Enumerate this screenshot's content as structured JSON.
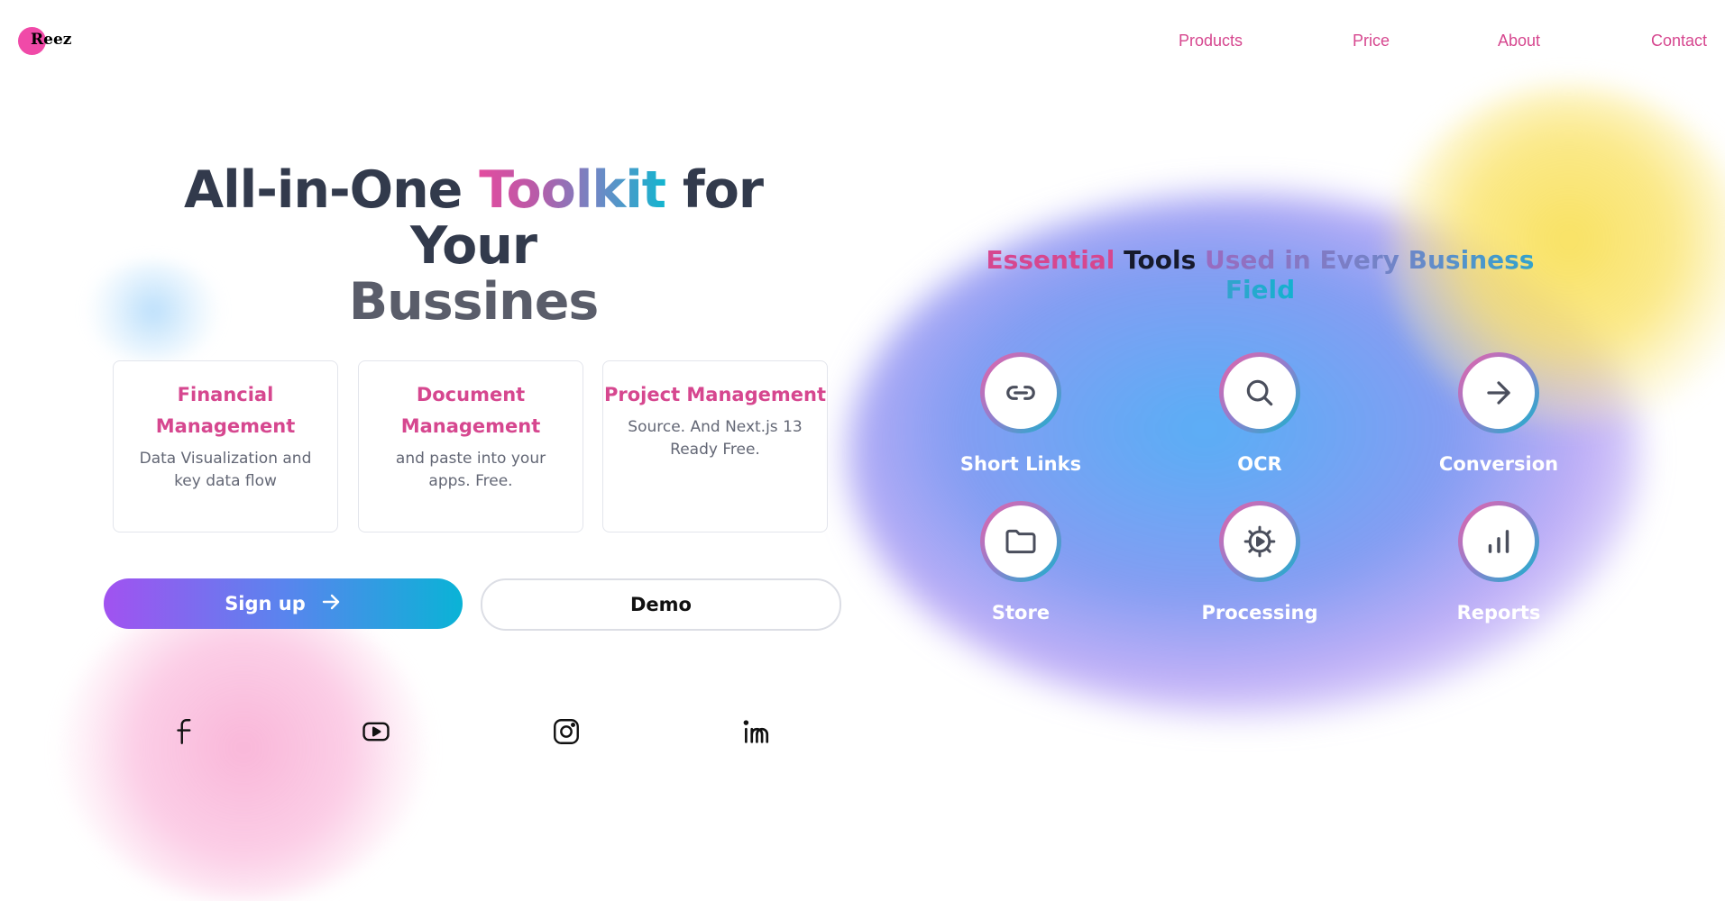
{
  "brand": {
    "name": "Reez",
    "color": "#f04aa8"
  },
  "nav": {
    "items": [
      {
        "label": "Products"
      },
      {
        "label": "Price"
      },
      {
        "label": "About"
      },
      {
        "label": "Contact"
      }
    ],
    "color": "#d6478f"
  },
  "hero": {
    "title_part1": "All-in-One ",
    "title_highlight": "Toolkit",
    "title_part2": " for Your",
    "title_line2": "Bussines"
  },
  "cards": [
    {
      "title": "Financial Management",
      "description": "Data Visualization and key data flow"
    },
    {
      "title": "Document Management",
      "description": "and paste into your apps. Free."
    },
    {
      "title": "Project Management",
      "description": "Source. And Next.js 13 Ready Free."
    }
  ],
  "buttons": {
    "signup_label": "Sign up",
    "demo_label": "Demo"
  },
  "social": [
    {
      "icon": "facebook-icon"
    },
    {
      "icon": "youtube-icon"
    },
    {
      "icon": "instagram-icon"
    },
    {
      "icon": "linkedin-icon"
    }
  ],
  "tools_section": {
    "heading_essential": "Essential",
    "heading_tools": "Tools",
    "heading_rest": "Used in Every Business Field",
    "tools": [
      {
        "label": "Short Links",
        "icon": "link-icon"
      },
      {
        "label": "OCR",
        "icon": "search-icon"
      },
      {
        "label": "Conversion",
        "icon": "arrow-right-icon"
      },
      {
        "label": "Store",
        "icon": "folder-icon"
      },
      {
        "label": "Processing",
        "icon": "gear-icon"
      },
      {
        "label": "Reports",
        "icon": "bar-chart-icon"
      }
    ]
  }
}
